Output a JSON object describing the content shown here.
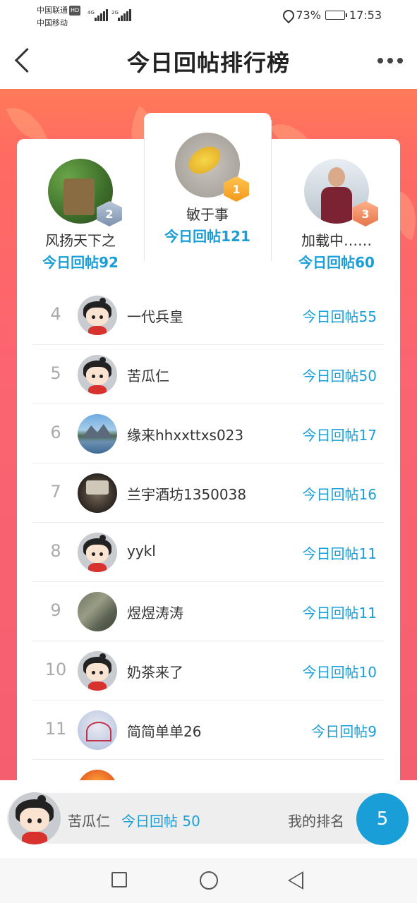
{
  "status_bar": {
    "carrier1": "中国联通",
    "carrier1_badge": "HD",
    "carrier2": "中国移动",
    "net1": "4G",
    "net2": "2G",
    "battery_text": "73%",
    "battery_level": 0.73,
    "time": "17:53"
  },
  "nav": {
    "title": "今日回帖排行榜"
  },
  "podium": [
    {
      "rank": "2",
      "name": "风扬天下之",
      "count_label": "今日回帖92",
      "avatar": "forest-photo"
    },
    {
      "rank": "1",
      "name": "敏于事",
      "count_label": "今日回帖121",
      "avatar": "leaf-photo"
    },
    {
      "rank": "3",
      "name": "加载中……",
      "count_label": "今日回帖60",
      "avatar": "man-photo"
    }
  ],
  "ranking_list": [
    {
      "rank": "4",
      "name": "一代兵皇",
      "count_label": "今日回帖55",
      "avatar": "default-avatar"
    },
    {
      "rank": "5",
      "name": "苦瓜仁",
      "count_label": "今日回帖50",
      "avatar": "default-avatar"
    },
    {
      "rank": "6",
      "name": "缘来hhxxttxs023",
      "count_label": "今日回帖17",
      "avatar": "lake-photo"
    },
    {
      "rank": "7",
      "name": "兰宇酒坊1350038",
      "count_label": "今日回帖16",
      "avatar": "dark-photo"
    },
    {
      "rank": "8",
      "name": "yykl",
      "count_label": "今日回帖11",
      "avatar": "default-avatar"
    },
    {
      "rank": "9",
      "name": "煜煜涛涛",
      "count_label": "今日回帖11",
      "avatar": "people-photo"
    },
    {
      "rank": "10",
      "name": "奶茶来了",
      "count_label": "今日回帖10",
      "avatar": "default-avatar"
    },
    {
      "rank": "11",
      "name": "简简单单26",
      "count_label": "今日回帖9",
      "avatar": "heart-photo"
    }
  ],
  "my_rank": {
    "name": "苦瓜仁",
    "count_label": "今日回帖 50",
    "rank_label": "我的排名",
    "rank": "5"
  },
  "colors": {
    "accent_blue": "#1a9ed8",
    "banner_red": "#f45f70"
  }
}
